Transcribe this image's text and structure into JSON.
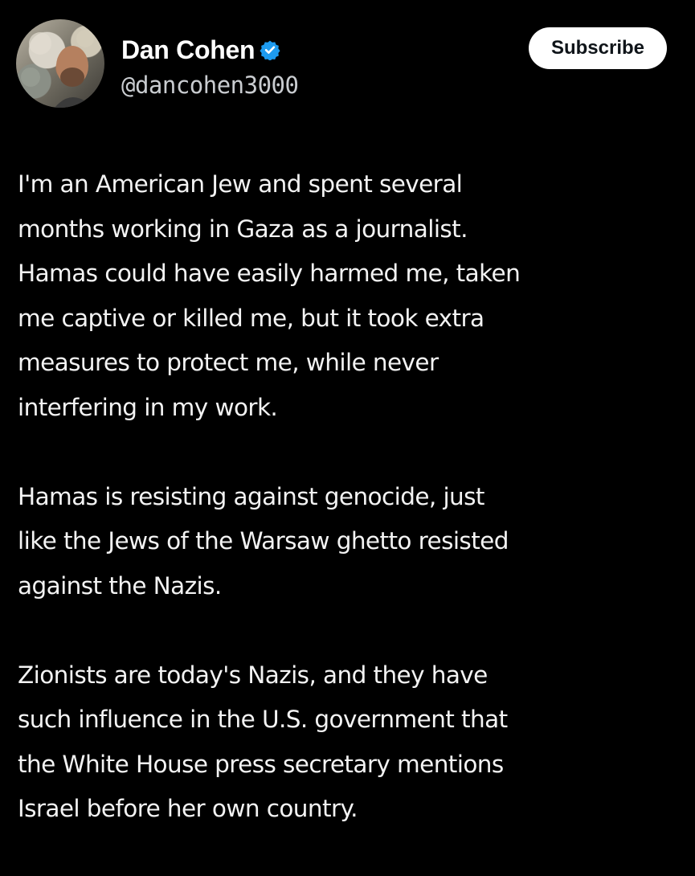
{
  "author": {
    "display_name": "Dan Cohen",
    "handle": "@dancohen3000",
    "avatar_icon": "profile-photo",
    "verified_icon": "verified-badge-icon",
    "verified_color": "#1d9bf0"
  },
  "actions": {
    "subscribe_label": "Subscribe"
  },
  "tweet": {
    "paragraphs": [
      "I'm an American Jew and spent several\nmonths working in Gaza as a journalist.\nHamas could have easily harmed me, taken\nme captive or killed me, but it took extra\nmeasures to protect me, while never\ninterfering in my work.",
      "Hamas is resisting against genocide, just\nlike the Jews of the Warsaw ghetto resisted\nagainst the Nazis.",
      "Zionists are today's Nazis, and they have\nsuch influence in the U.S. government that\nthe White House press secretary mentions\nIsrael before her own country."
    ]
  },
  "colors": {
    "background": "#000000",
    "text": "#ffffff",
    "secondary_text": "#c9ccd0",
    "button_bg": "#ffffff",
    "button_text": "#0f1419"
  }
}
